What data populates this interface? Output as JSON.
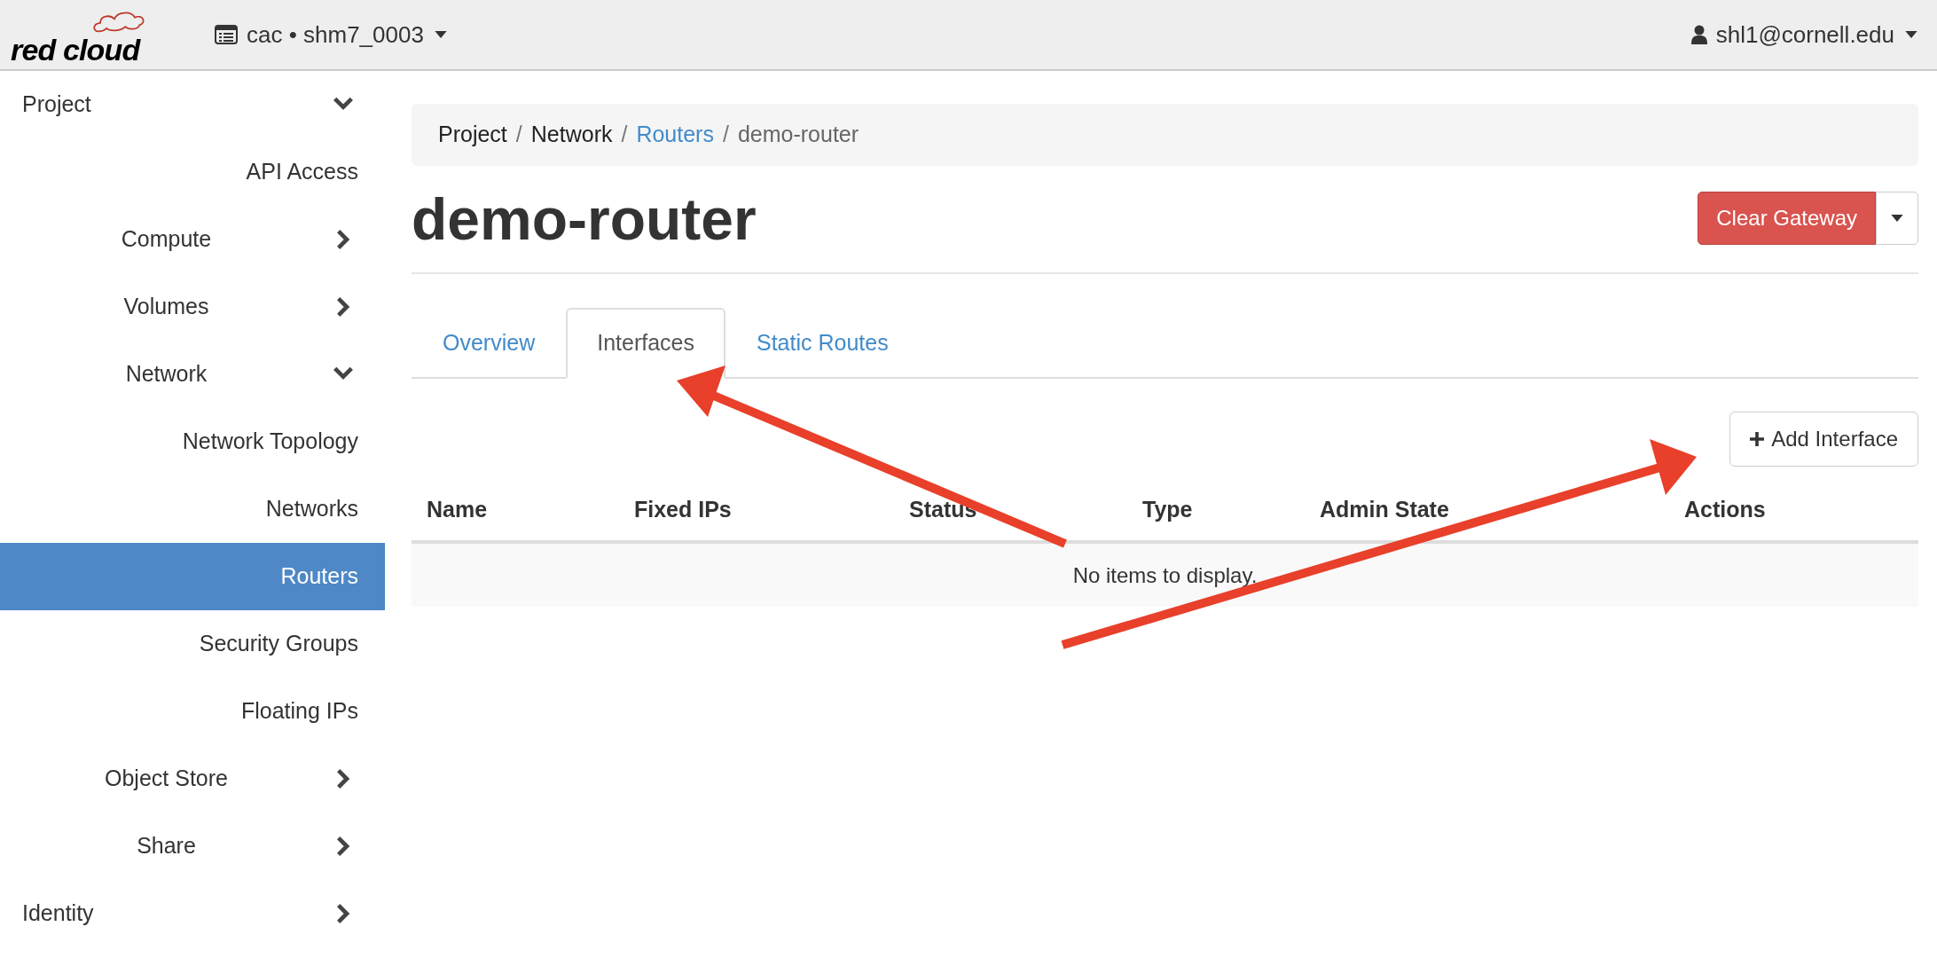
{
  "header": {
    "logo_text": "red cloud",
    "project_selector": "cac • shm7_0003",
    "user_menu": "shl1@cornell.edu"
  },
  "sidebar": {
    "items": [
      {
        "label": "Project",
        "kind": "section",
        "expanded": true,
        "children": [
          {
            "label": "API Access",
            "kind": "link",
            "selected": false
          },
          {
            "label": "Compute",
            "kind": "panel",
            "expanded": false
          },
          {
            "label": "Volumes",
            "kind": "panel",
            "expanded": false
          },
          {
            "label": "Network",
            "kind": "panel",
            "expanded": true,
            "children": [
              {
                "label": "Network Topology",
                "kind": "link",
                "selected": false
              },
              {
                "label": "Networks",
                "kind": "link",
                "selected": false
              },
              {
                "label": "Routers",
                "kind": "link",
                "selected": true
              },
              {
                "label": "Security Groups",
                "kind": "link",
                "selected": false
              },
              {
                "label": "Floating IPs",
                "kind": "link",
                "selected": false
              }
            ]
          },
          {
            "label": "Object Store",
            "kind": "panel",
            "expanded": false
          },
          {
            "label": "Share",
            "kind": "panel",
            "expanded": false
          }
        ]
      },
      {
        "label": "Identity",
        "kind": "section",
        "expanded": false
      }
    ]
  },
  "breadcrumb_separator": "/",
  "breadcrumb": [
    {
      "label": "Project",
      "kind": "text"
    },
    {
      "label": "Network",
      "kind": "text"
    },
    {
      "label": "Routers",
      "kind": "link"
    },
    {
      "label": "demo-router",
      "kind": "current"
    }
  ],
  "page_title": "demo-router",
  "actions": {
    "primary": "Clear Gateway"
  },
  "tabs": [
    {
      "label": "Overview",
      "selected": false
    },
    {
      "label": "Interfaces",
      "selected": true
    },
    {
      "label": "Static Routes",
      "selected": false
    }
  ],
  "table": {
    "add_button": "Add Interface",
    "columns": [
      "Name",
      "Fixed IPs",
      "Status",
      "Type",
      "Admin State",
      "Actions"
    ],
    "empty_message": "No items to display."
  }
}
